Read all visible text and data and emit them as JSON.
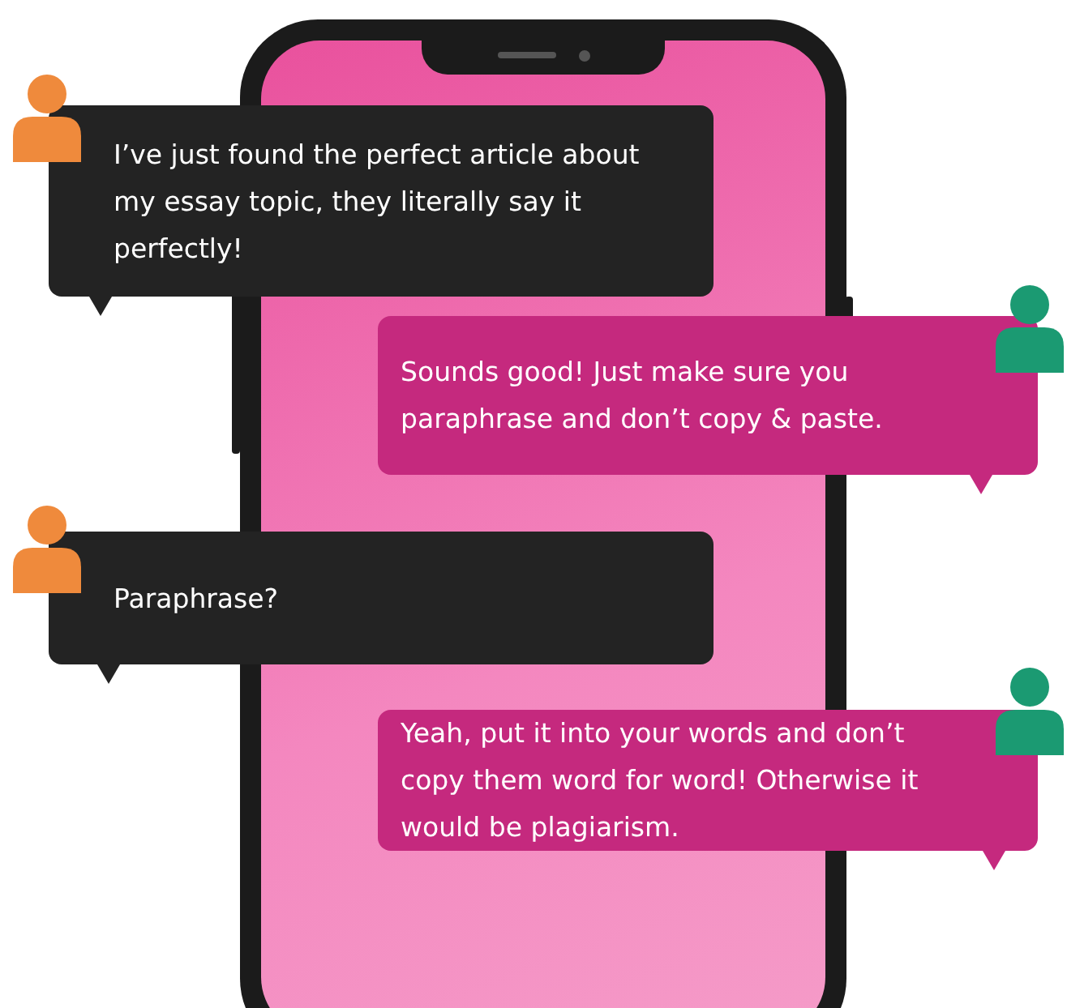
{
  "messages": [
    {
      "kind": "received",
      "text": "I’ve just found the perfect article about my essay topic, they literally say it perfectly!"
    },
    {
      "kind": "sent",
      "text": "Sounds good! Just make sure you paraphrase and don’t copy & paste."
    },
    {
      "kind": "received",
      "text": "Paraphrase?"
    },
    {
      "kind": "sent",
      "text": "Yeah, put it into your words and don’t copy them word for word! Otherwise it would be plagiarism."
    }
  ]
}
